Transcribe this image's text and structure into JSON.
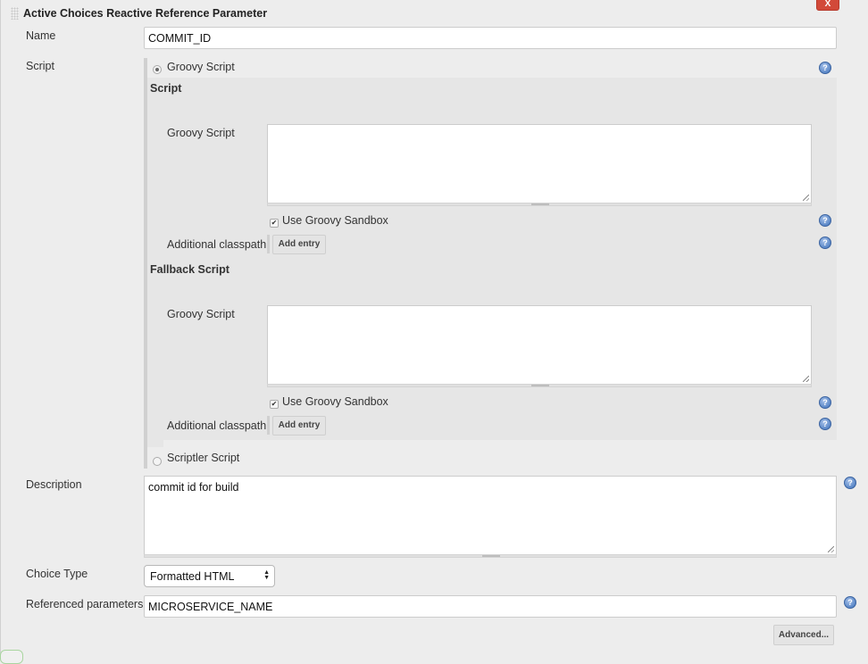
{
  "header": {
    "title": "Active Choices Reactive Reference Parameter",
    "delete_label": "X"
  },
  "name": {
    "label": "Name",
    "value": "COMMIT_ID"
  },
  "script": {
    "label": "Script",
    "options": [
      {
        "label": "Groovy Script",
        "selected": true
      },
      {
        "label": "Scriptler Script",
        "selected": false
      }
    ],
    "main": {
      "section_title": "Script",
      "groovy_label": "Groovy Script",
      "groovy_value": "",
      "sandbox_label": "Use Groovy Sandbox",
      "sandbox_checked": true,
      "classpath_label": "Additional classpath",
      "add_entry_label": "Add entry"
    },
    "fallback": {
      "section_title": "Fallback Script",
      "groovy_label": "Groovy Script",
      "groovy_value": "",
      "sandbox_label": "Use Groovy Sandbox",
      "sandbox_checked": true,
      "classpath_label": "Additional classpath",
      "add_entry_label": "Add entry"
    }
  },
  "description": {
    "label": "Description",
    "value": "commit id for build"
  },
  "choice_type": {
    "label": "Choice Type",
    "selected": "Formatted HTML"
  },
  "referenced_parameters": {
    "label": "Referenced parameters",
    "value": "MICROSERVICE_NAME"
  },
  "advanced_label": "Advanced...",
  "help_glyph": "?",
  "check_glyph": "✔",
  "select_arrows": "▲▼"
}
